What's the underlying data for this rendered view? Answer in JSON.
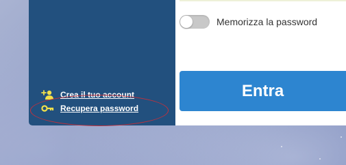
{
  "remember": {
    "label": "Memorizza la password",
    "checked": false
  },
  "login": {
    "button_label": "Entra"
  },
  "links": {
    "create_account": "Crea il tuo account",
    "recover_password": "Recupera password"
  },
  "icons": {
    "create_account": "user-plus-icon",
    "recover_password": "key-icon"
  },
  "colors": {
    "side_panel": "#22507e",
    "button": "#2d85d0",
    "icon_yellow": "#f2e04a",
    "annotation": "#c6303a"
  }
}
